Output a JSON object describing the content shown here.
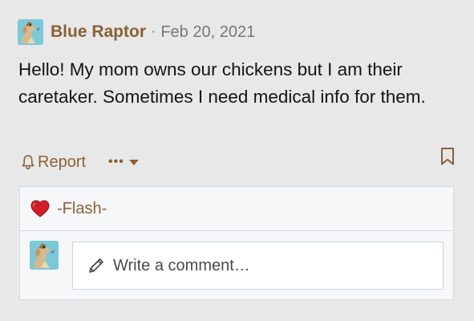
{
  "post": {
    "author": "Blue Raptor",
    "separator": "·",
    "date": "Feb 20, 2021",
    "message": "Hello! My mom owns our chickens but I am their caretaker. Sometimes I need medical info for them."
  },
  "actions": {
    "report_label": "Report",
    "more_label": "•••"
  },
  "reactions": {
    "reaction_icon": "heart-icon",
    "reactors": "-Flash-"
  },
  "comment": {
    "placeholder": "Write a comment…"
  },
  "colors": {
    "accent": "#8a6136",
    "background": "#e8e8e8",
    "panel": "#f6f7f9",
    "heart": "#d21e2b"
  }
}
